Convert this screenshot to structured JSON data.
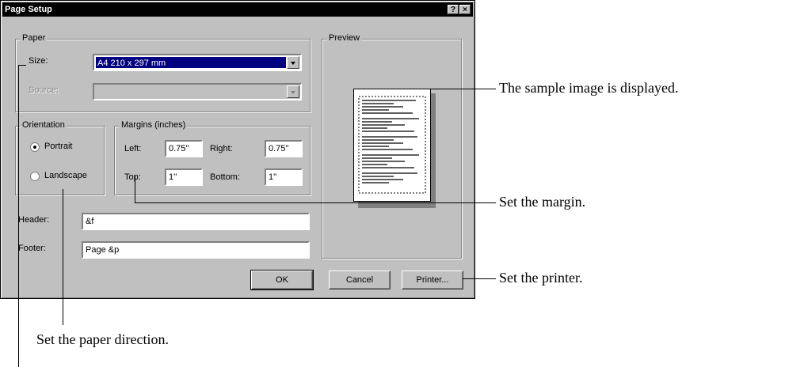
{
  "dialog": {
    "title": "Page Setup",
    "help_glyph": "?",
    "close_glyph": "×"
  },
  "paper": {
    "group_label": "Paper",
    "size_label": "Size:",
    "size_value": "A4 210 x 297 mm",
    "source_label": "Source:",
    "source_value": ""
  },
  "orientation": {
    "group_label": "Orientation",
    "portrait": "Portrait",
    "landscape": "Landscape",
    "selected": "portrait"
  },
  "margins": {
    "group_label": "Margins (inches)",
    "left_label": "Left:",
    "left_value": "0.75''",
    "right_label": "Right:",
    "right_value": "0.75''",
    "top_label": "Top:",
    "top_value": "1''",
    "bottom_label": "Bottom:",
    "bottom_value": "1''"
  },
  "header": {
    "label": "Header:",
    "value": "&f"
  },
  "footer": {
    "label": "Footer:",
    "value": "Page &p"
  },
  "preview": {
    "group_label": "Preview"
  },
  "buttons": {
    "ok": "OK",
    "cancel": "Cancel",
    "printer": "Printer..."
  },
  "annotations": {
    "sample": "The sample image is displayed.",
    "margin": "Set the margin.",
    "printer": "Set the printer.",
    "direction": "Set the paper direction."
  }
}
